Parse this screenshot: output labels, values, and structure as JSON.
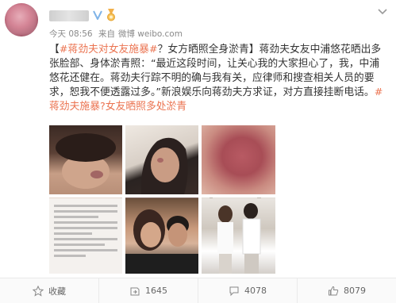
{
  "post": {
    "meta": {
      "time": "今天 08:56",
      "source_prefix": "来自",
      "source": "微博 weibo.com"
    },
    "content": {
      "prefix": "【",
      "topic1": "#蒋劲夫对女友施暴#",
      "title_rest": "？女方晒照全身淤青】",
      "body": "蒋劲夫女友中浦悠花晒出多张脸部、身体淤青照：“最近这段时间，让关心我的大家担心了，我，中浦悠花还健在。蒋劲夫行踪不明的确与我有关，应律师和搜查相关人员的要求，恕我不便透露过多。”新浪娱乐向蒋劲夫方求证，对方直接挂断电话。",
      "topic2": "#蒋劲夫施暴?女友晒照多处淤青"
    },
    "icons": {
      "verified": "verified-v-icon",
      "medal": "medal-icon",
      "menu": "chevron-down-icon"
    }
  },
  "footer": {
    "favorite_label": "收藏",
    "repost_count": "1645",
    "comment_count": "4078",
    "like_count": "8079"
  },
  "colors": {
    "topic": "#eb7350",
    "meta": "#8a8a8a",
    "text": "#333333"
  }
}
